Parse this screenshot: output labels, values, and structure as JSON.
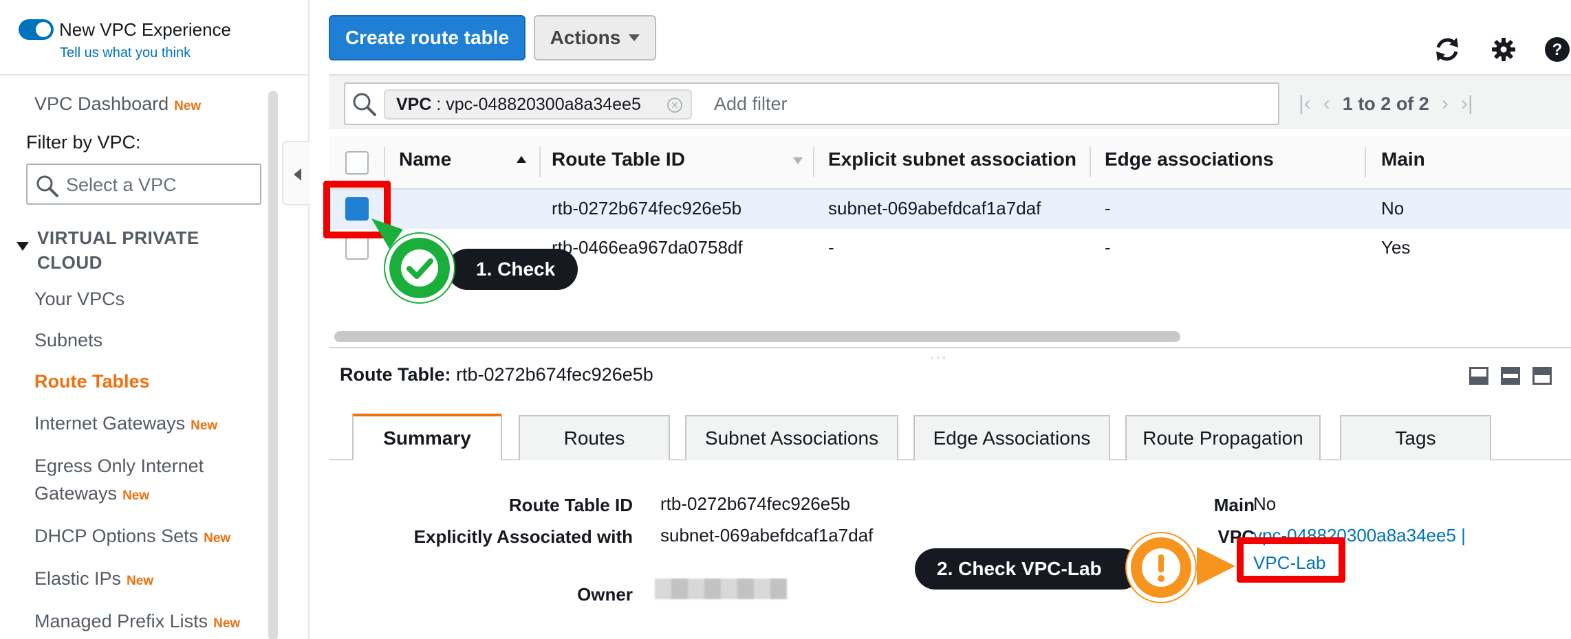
{
  "sidebar": {
    "toggle_label": "New VPC Experience",
    "feedback_link": "Tell us what you think",
    "dashboard": "VPC Dashboard",
    "new_badge": "New",
    "filter_label": "Filter by VPC:",
    "select_placeholder": "Select a VPC",
    "section_title": "VIRTUAL PRIVATE CLOUD",
    "items": [
      {
        "label": "Your VPCs",
        "new": false
      },
      {
        "label": "Subnets",
        "new": false
      },
      {
        "label": "Route Tables",
        "new": false,
        "active": true
      },
      {
        "label": "Internet Gateways",
        "new": true
      },
      {
        "label": "Egress Only Internet",
        "label2": "Gateways",
        "new": true
      },
      {
        "label": "DHCP Options Sets",
        "new": true
      },
      {
        "label": "Elastic IPs",
        "new": true
      },
      {
        "label": "Managed Prefix Lists",
        "new": true
      }
    ]
  },
  "toolbar": {
    "create_label": "Create route table",
    "actions_label": "Actions"
  },
  "icons": {
    "refresh": "refresh-icon",
    "settings": "gear-icon",
    "help": "help-icon"
  },
  "filter": {
    "token_key": "VPC",
    "token_sep": " : ",
    "token_value": "vpc-048820300a8a34ee5",
    "add_placeholder": "Add filter",
    "pager_text": "1 to 2 of 2"
  },
  "table": {
    "columns": [
      "Name",
      "Route Table ID",
      "Explicit subnet association",
      "Edge associations",
      "Main"
    ],
    "rows": [
      {
        "name": "",
        "id": "rtb-0272b674fec926e5b",
        "subnet": "subnet-069abefdcaf1a7daf",
        "edge": "-",
        "main": "No",
        "selected": true
      },
      {
        "name": "",
        "id": "rtb-0466ea967da0758df",
        "subnet": "-",
        "edge": "-",
        "main": "Yes",
        "selected": false
      }
    ]
  },
  "detail": {
    "title_label": "Route Table:",
    "title_value": "rtb-0272b674fec926e5b",
    "tabs": [
      "Summary",
      "Routes",
      "Subnet Associations",
      "Edge Associations",
      "Route Propagation",
      "Tags"
    ],
    "active_tab": "Summary",
    "fields": {
      "rtid_label": "Route Table ID",
      "rtid_value": "rtb-0272b674fec926e5b",
      "assoc_label": "Explicitly Associated with",
      "assoc_value": "subnet-069abefdcaf1a7daf",
      "owner_label": "Owner",
      "main_label": "Main",
      "main_value": "No",
      "vpc_label": "VPC",
      "vpc_value": "vpc-048820300a8a34ee5 |",
      "vpc_name": "VPC-Lab"
    }
  },
  "annotations": {
    "step1": "1. Check",
    "step2": "2. Check VPC-Lab"
  },
  "colors": {
    "accent_orange": "#ec7211",
    "link_blue": "#0073bb",
    "primary_button": "#1f7fd4",
    "highlight_red": "#f20000",
    "badge_green": "#1aae3a",
    "badge_orange": "#f7941d"
  }
}
